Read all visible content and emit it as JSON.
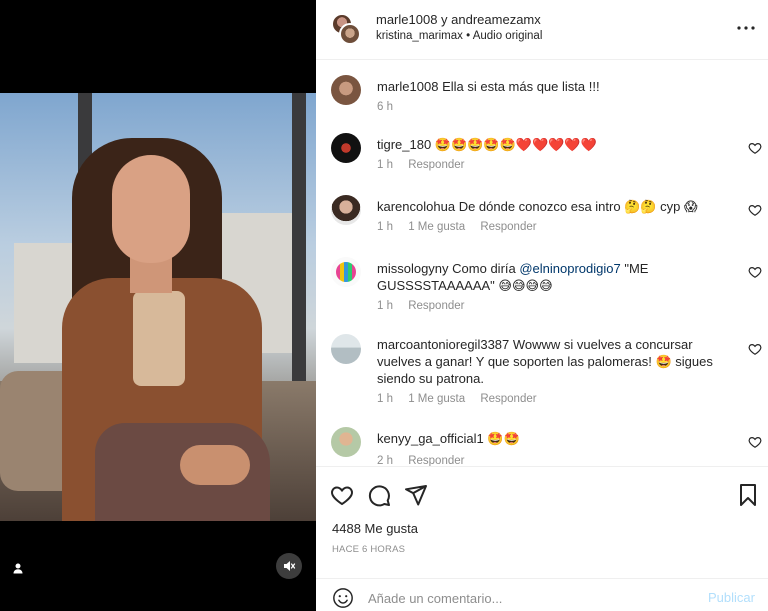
{
  "post": {
    "authors": "marle1008 y andreamezamx",
    "subline": "kristina_marimax • Audio original",
    "likes": "4488 Me gusta",
    "time_ago": "HACE 6 HORAS"
  },
  "comments": [
    {
      "user": "marle1008",
      "text": "Ella si esta más que lista !!!",
      "time": "6 h",
      "likes": "",
      "reply": ""
    },
    {
      "user": "tigre_180",
      "text": "🤩🤩🤩🤩🤩❤️❤️❤️❤️❤️",
      "time": "1 h",
      "likes": "",
      "reply": "Responder"
    },
    {
      "user": "karencolohua",
      "text": "De dónde conozco esa intro 🤔🤔 cyp 😱",
      "time": "1 h",
      "likes": "1 Me gusta",
      "reply": "Responder"
    },
    {
      "user": "missologyny",
      "text_before": "Como diría ",
      "mention": "@elninoprodigio7",
      "text_after": " \"ME GUSSSSTAAAAAA\" 😅😅😅😅",
      "time": "1 h",
      "likes": "",
      "reply": "Responder"
    },
    {
      "user": "marcoantonioregil3387",
      "text": "Wowww si vuelves a concursar vuelves a ganar! Y que soporten las palomeras! 🤩 sigues siendo su patrona.",
      "time": "1 h",
      "likes": "1 Me gusta",
      "reply": "Responder"
    },
    {
      "user": "kenyy_ga_official1",
      "text": "🤩🤩",
      "time": "2 h",
      "likes": "",
      "reply": "Responder"
    }
  ],
  "add_comment": {
    "placeholder": "Añade un comentario...",
    "publish_label": "Publicar"
  },
  "colors": {
    "link": "#00376b",
    "publish_disabled": "#b2dffc",
    "meta": "#8e8e8e"
  }
}
